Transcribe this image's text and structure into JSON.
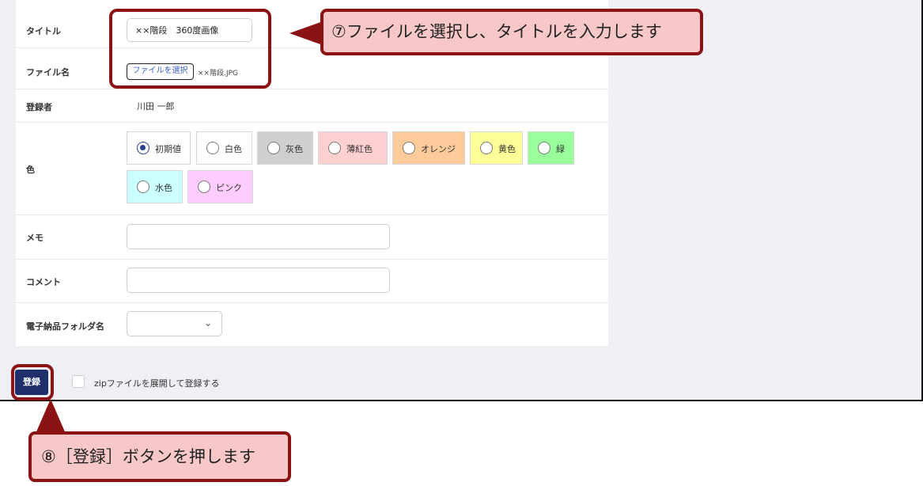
{
  "form": {
    "title_label": "タイトル",
    "title_value": "××階段　360度画像",
    "file_label": "ファイル名",
    "file_button": "ファイルを選択",
    "file_name": "××階段.JPG",
    "registrant_label": "登録者",
    "registrant_value": "川田 一郎",
    "color_label": "色",
    "colors": [
      {
        "label": "初期値",
        "bg": "#ffffff",
        "checked": true
      },
      {
        "label": "白色",
        "bg": "#ffffff",
        "checked": false
      },
      {
        "label": "灰色",
        "bg": "#cfcfcf",
        "checked": false
      },
      {
        "label": "薄紅色",
        "bg": "#ffd0d0",
        "checked": false
      },
      {
        "label": "オレンジ",
        "bg": "#ffcc99",
        "checked": false
      },
      {
        "label": "黄色",
        "bg": "#ffff99",
        "checked": false
      },
      {
        "label": "緑",
        "bg": "#99ff99",
        "checked": false
      },
      {
        "label": "水色",
        "bg": "#ccffff",
        "checked": false
      },
      {
        "label": "ピンク",
        "bg": "#ffccff",
        "checked": false
      }
    ],
    "memo_label": "メモ",
    "memo_value": "",
    "comment_label": "コメント",
    "comment_value": "",
    "folder_label": "電子納品フォルダ名",
    "folder_value": ""
  },
  "footer": {
    "submit_label": "登録",
    "zip_label": "zipファイルを展開して登録する",
    "zip_checked": false
  },
  "callouts": {
    "step7": "⑦ファイルを選択し、タイトルを入力します",
    "step8": "⑧［登録］ボタンを押します"
  },
  "colors": {
    "accent": "#1f2f6e",
    "callout_border": "#8c1313",
    "callout_fill": "#f8c7c7"
  }
}
